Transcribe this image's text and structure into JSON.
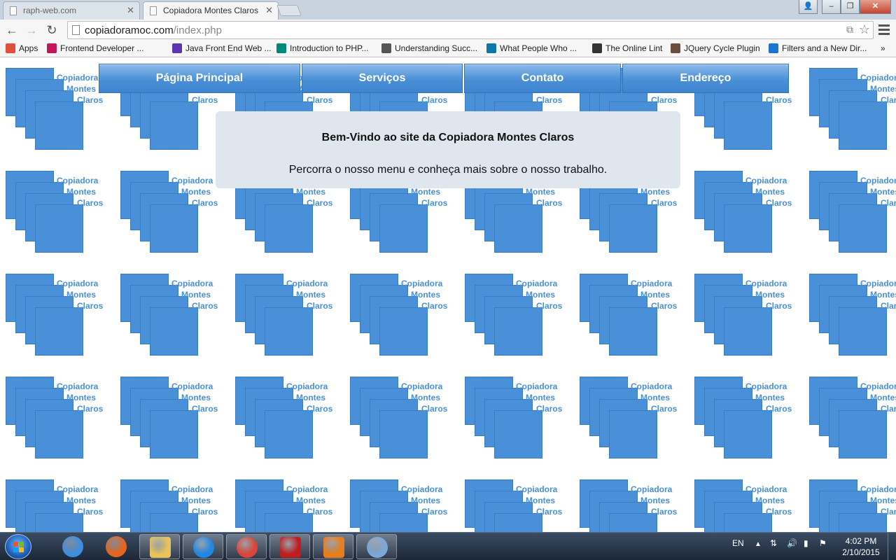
{
  "browser": {
    "tabs": [
      {
        "title": "raph-web.com",
        "active": false
      },
      {
        "title": "Copiadora Montes Claros",
        "active": true
      }
    ],
    "url_host": "copiadoramoc.com",
    "url_path": "/index.php",
    "bookmarks": [
      {
        "label": "Apps",
        "icon": "apps-grid-icon",
        "color": "#e04f3c"
      },
      {
        "label": "Frontend Developer ...",
        "icon": "frontend-icon",
        "color": "#c2185b"
      },
      {
        "label": "Java Front End Web ...",
        "icon": "monster-icon",
        "color": "#5e35b1"
      },
      {
        "label": "Introduction to PHP...",
        "icon": "page-icon",
        "color": "#00897b"
      },
      {
        "label": "Understanding Succ...",
        "icon": "w3-icon",
        "color": "#555555"
      },
      {
        "label": "What People Who ...",
        "icon": "linkedin-icon",
        "color": "#0e76a8"
      },
      {
        "label": "The Online Lint",
        "icon": "jsl-icon",
        "color": "#333333"
      },
      {
        "label": "JQuery Cycle Plugin",
        "icon": "avatar-icon",
        "color": "#6d4c41"
      },
      {
        "label": "Filters and a New Dir...",
        "icon": "code-icon",
        "color": "#1976d2"
      }
    ],
    "more_label": "»",
    "apps_label": "Apps"
  },
  "page": {
    "logo_words": [
      "Copiadora",
      "Montes",
      "Claros"
    ],
    "menu": [
      "Página Principal",
      "Serviços",
      "Contato",
      "Endereço"
    ],
    "welcome_title": "Bem-Vindo ao site da Copiadora Montes Claros",
    "welcome_text": "Percorra o nosso menu e conheça mais sobre o nosso trabalho.",
    "accent_color": "#4a90d9"
  },
  "taskbar": {
    "apps": [
      "safari-icon",
      "firefox-icon",
      "file-explorer-icon",
      "internet-explorer-icon",
      "chrome-icon",
      "filezilla-icon",
      "settings-icon",
      "paint-icon"
    ],
    "language": "EN",
    "time": "4:02 PM",
    "date": "2/10/2015"
  }
}
